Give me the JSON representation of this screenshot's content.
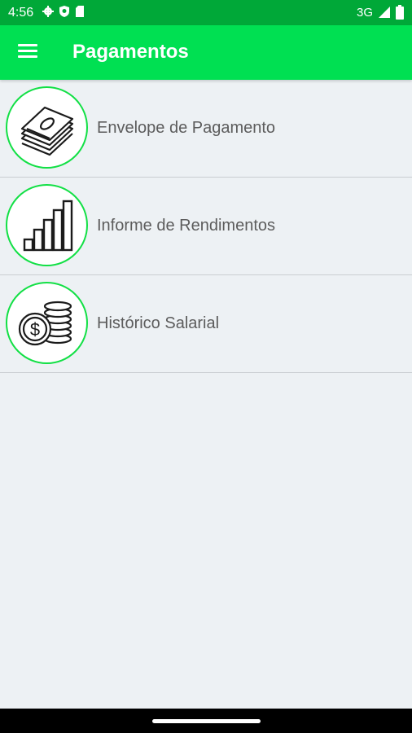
{
  "status_bar": {
    "time": "4:56",
    "network": "3G",
    "icons": [
      "gear-icon",
      "shield-icon",
      "sim-icon",
      "signal-icon",
      "battery-icon"
    ]
  },
  "app_bar": {
    "title": "Pagamentos",
    "menu_icon": "hamburger-menu-icon"
  },
  "menu": {
    "items": [
      {
        "label": "Envelope de Pagamento",
        "icon": "money-stack-icon"
      },
      {
        "label": "Informe de Rendimentos",
        "icon": "bar-chart-icon"
      },
      {
        "label": "Histórico Salarial",
        "icon": "coins-icon"
      }
    ]
  },
  "colors": {
    "status_bar": "#00a838",
    "app_bar": "#00e052",
    "circle_border": "#12e045",
    "background": "#edf1f4",
    "label_text": "#5c5c5c"
  }
}
